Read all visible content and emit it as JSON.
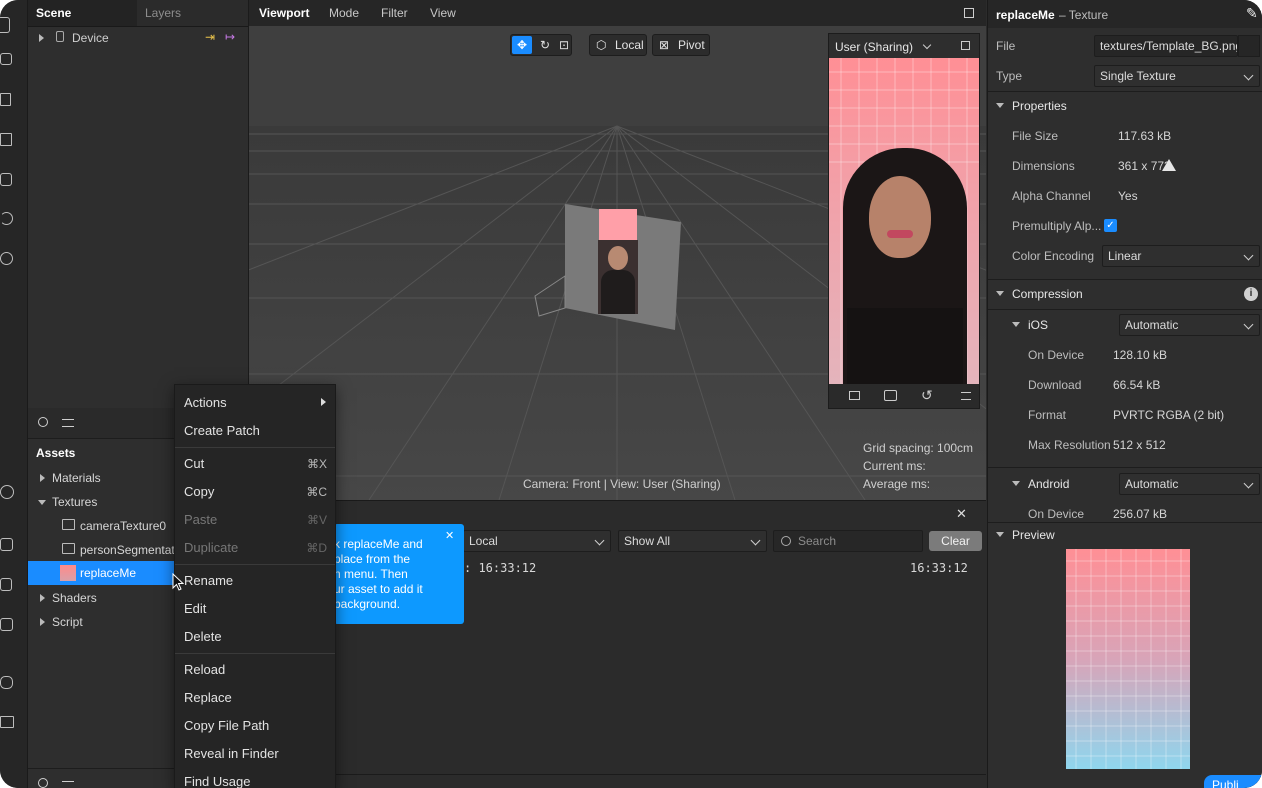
{
  "scene_panel": {
    "tabs": [
      "Scene",
      "Layers"
    ],
    "tree": [
      {
        "label": "Device"
      }
    ]
  },
  "assets_panel": {
    "title": "Assets",
    "items": [
      {
        "label": "Materials"
      },
      {
        "label": "Textures"
      },
      {
        "label": "cameraTexture0"
      },
      {
        "label": "personSegmentati"
      },
      {
        "label": "replaceMe"
      },
      {
        "label": "Shaders"
      },
      {
        "label": "Script"
      }
    ]
  },
  "viewport": {
    "tabs": [
      "Viewport",
      "Mode",
      "Filter",
      "View"
    ],
    "tools": {
      "local": "Local",
      "pivot": "Pivot"
    },
    "camera_info": "Camera: Front | View: User (Sharing)",
    "preview": {
      "title": "User (Sharing)"
    },
    "stats": {
      "grid_spacing": "Grid spacing: 100cm",
      "current_ms": "Current ms:",
      "average_ms": "Average ms:"
    }
  },
  "console": {
    "scope": "Local",
    "filter": "Show All",
    "search_placeholder": "Search",
    "clear_label": "Clear",
    "log_fragment": ": 16:33:12",
    "log_time": "16:33:12"
  },
  "tooltip": {
    "lines": [
      "k replaceMe and",
      "place from the",
      "n menu. Then",
      "ur asset to add it",
      "background."
    ]
  },
  "context_menu": {
    "items": [
      {
        "label": "Actions",
        "shortcut": "",
        "disabled": false
      },
      {
        "label": "Create Patch",
        "shortcut": "",
        "disabled": false
      },
      {
        "label": "Cut",
        "shortcut": "⌘X",
        "disabled": false
      },
      {
        "label": "Copy",
        "shortcut": "⌘C",
        "disabled": false
      },
      {
        "label": "Paste",
        "shortcut": "⌘V",
        "disabled": true
      },
      {
        "label": "Duplicate",
        "shortcut": "⌘D",
        "disabled": true
      },
      {
        "label": "Rename",
        "shortcut": "",
        "disabled": false
      },
      {
        "label": "Edit",
        "shortcut": "",
        "disabled": false
      },
      {
        "label": "Delete",
        "shortcut": "",
        "disabled": false
      },
      {
        "label": "Reload",
        "shortcut": "",
        "disabled": false
      },
      {
        "label": "Replace",
        "shortcut": "",
        "disabled": false
      },
      {
        "label": "Copy File Path",
        "shortcut": "",
        "disabled": false
      },
      {
        "label": "Reveal in Finder",
        "shortcut": "",
        "disabled": false
      },
      {
        "label": "Find Usage",
        "shortcut": "",
        "disabled": false
      }
    ]
  },
  "inspector": {
    "title": "replaceMe",
    "subtitle": "– Texture",
    "file_label": "File",
    "file_value": "textures/Template_BG.png",
    "type_label": "Type",
    "type_value": "Single Texture",
    "properties": {
      "title": "Properties",
      "file_size_label": "File Size",
      "file_size": "117.63 kB",
      "dimensions_label": "Dimensions",
      "dimensions": "361 x 773",
      "alpha_label": "Alpha Channel",
      "alpha": "Yes",
      "premultiply_label": "Premultiply Alp...",
      "color_encoding_label": "Color Encoding",
      "color_encoding": "Linear"
    },
    "compression": {
      "title": "Compression",
      "ios_label": "iOS",
      "ios_mode": "Automatic",
      "on_device_label": "On Device",
      "ios_on_device": "128.10 kB",
      "download_label": "Download",
      "ios_download": "66.54 kB",
      "format_label": "Format",
      "ios_format": "PVRTC RGBA (2 bit)",
      "max_res_label": "Max Resolution",
      "ios_max_res": "512 x 512",
      "android_label": "Android",
      "android_mode": "Automatic",
      "android_on_device": "256.07 kB"
    },
    "preview_title": "Preview",
    "publish_label": "Publi"
  },
  "colors": {
    "accent": "#1a8cff",
    "tooltip": "#0d99ff",
    "warn": "#e6e6e6"
  }
}
